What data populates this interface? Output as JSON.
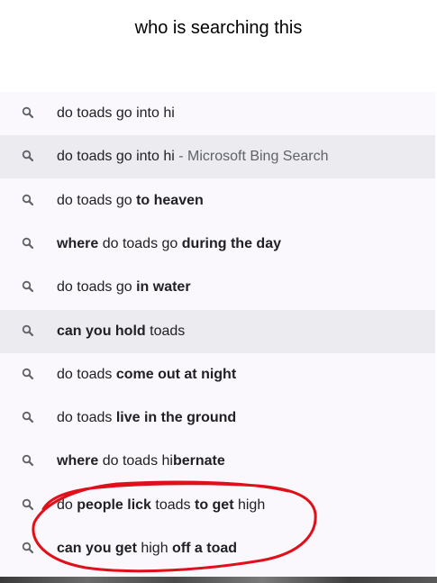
{
  "caption": "who is searching this",
  "suggestions": [
    {
      "parts": [
        {
          "t": "do toads go into hi",
          "b": false
        }
      ],
      "suffix": "",
      "highlight": false
    },
    {
      "parts": [
        {
          "t": "do toads go into hi",
          "b": false
        }
      ],
      "suffix": " - Microsoft Bing Search",
      "highlight": true
    },
    {
      "parts": [
        {
          "t": "do toads go ",
          "b": false
        },
        {
          "t": "to heaven",
          "b": true
        }
      ],
      "suffix": "",
      "highlight": false
    },
    {
      "parts": [
        {
          "t": "where",
          "b": true
        },
        {
          "t": " do toads go ",
          "b": false
        },
        {
          "t": "during the day",
          "b": true
        }
      ],
      "suffix": "",
      "highlight": false
    },
    {
      "parts": [
        {
          "t": "do toads go ",
          "b": false
        },
        {
          "t": "in water",
          "b": true
        }
      ],
      "suffix": "",
      "highlight": false
    },
    {
      "parts": [
        {
          "t": "can you hold",
          "b": true
        },
        {
          "t": " toads",
          "b": false
        }
      ],
      "suffix": "",
      "highlight": true
    },
    {
      "parts": [
        {
          "t": "do toads ",
          "b": false
        },
        {
          "t": "come out at night",
          "b": true
        }
      ],
      "suffix": "",
      "highlight": false
    },
    {
      "parts": [
        {
          "t": "do toads ",
          "b": false
        },
        {
          "t": "live in the ground",
          "b": true
        }
      ],
      "suffix": "",
      "highlight": false
    },
    {
      "parts": [
        {
          "t": "where",
          "b": true
        },
        {
          "t": " do toads hi",
          "b": false
        },
        {
          "t": "bernate",
          "b": true
        }
      ],
      "suffix": "",
      "highlight": false
    },
    {
      "parts": [
        {
          "t": "do ",
          "b": false
        },
        {
          "t": "people lick",
          "b": true
        },
        {
          "t": " toads ",
          "b": false
        },
        {
          "t": "to get",
          "b": true
        },
        {
          "t": " high",
          "b": false
        }
      ],
      "suffix": "",
      "highlight": false
    },
    {
      "parts": [
        {
          "t": "can you get",
          "b": true
        },
        {
          "t": " high ",
          "b": false
        },
        {
          "t": "off a toad",
          "b": true
        }
      ],
      "suffix": "",
      "highlight": false
    }
  ],
  "icon": "search-icon",
  "colors": {
    "dropdown_bg": "#fbf8fd",
    "highlight_bg": "#ecebef",
    "text": "#202124",
    "suffix": "#5f6368",
    "annotation": "#e0101a"
  }
}
